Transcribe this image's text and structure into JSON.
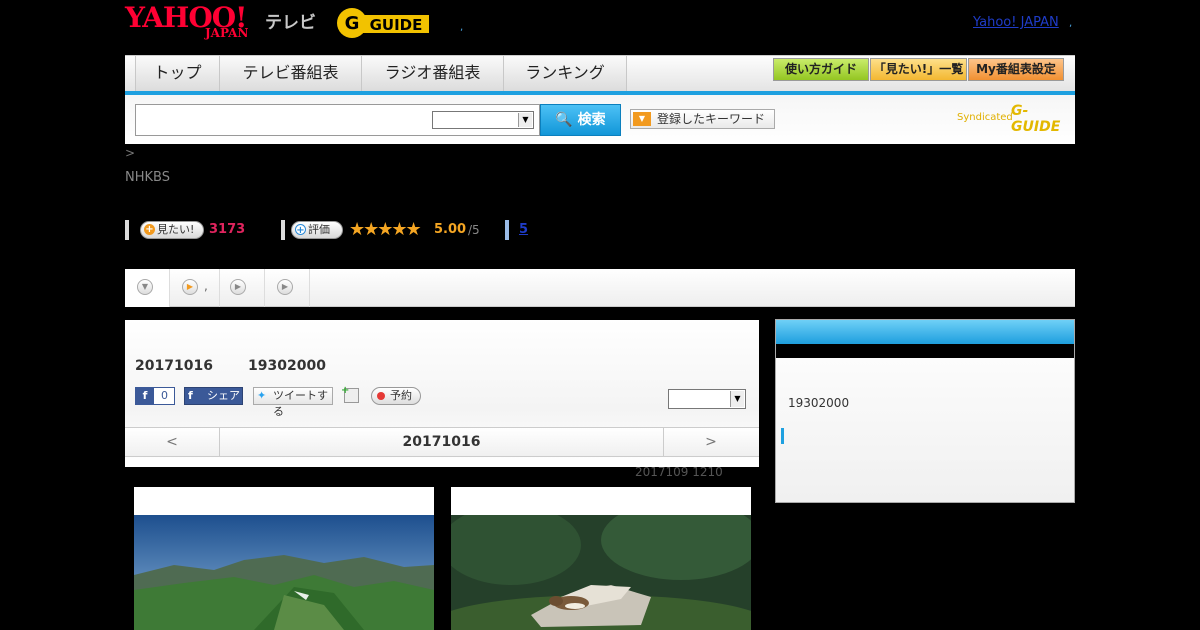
{
  "header": {
    "yahoo_logo": "YAHOO!",
    "yahoo_sub": "JAPAN",
    "tv_label": "テレビ",
    "gguide_logo": "G-GUIDE",
    "sep_dot": ",",
    "yahoo_japan_link": "Yahoo! JAPAN",
    "trailing_dot": ","
  },
  "nav": {
    "tabs": [
      "トップ",
      "テレビ番組表",
      "ラジオ番組表",
      "ランキング"
    ],
    "buttons": [
      "使い方ガイド",
      "「見たい!」一覧",
      "My番組表設定"
    ],
    "button_colors": [
      "#a6d63a",
      "#f6c84a",
      "#f6a24a"
    ]
  },
  "search": {
    "input_value": "",
    "select_value": "",
    "button_label": "検索",
    "keyword_button_label": "登録したキーワード",
    "syndicated_label": "Syndicated",
    "syndicated_logo": "G-GUIDE"
  },
  "info": {
    "breadcrumb": ">",
    "channel": "NHKBS",
    "want_label": "見たい!",
    "want_count": "3173",
    "rate_label": "評価",
    "stars": "★★★★★",
    "score": "5.00",
    "score_max": "/5",
    "reviews_link": "5"
  },
  "subtabs": [
    {
      "icon": "▼",
      "label": ""
    },
    {
      "icon": "▶",
      "label": ","
    },
    {
      "icon": "▶",
      "label": ""
    },
    {
      "icon": "▶",
      "label": ""
    }
  ],
  "main": {
    "date": "20171016",
    "time": "19302000",
    "fb_like_count": "0",
    "fb_share_label": "シェア",
    "tweet_label": "ツイートする",
    "reserve_label": "予約",
    "select_value": "",
    "prev": "<",
    "next": ">",
    "nav_date": "20171016",
    "updated": "2017109  1210"
  },
  "side": {
    "time": "19302000"
  },
  "colors": {
    "accent": "#1ea0e0",
    "count": "#e0245e",
    "star": "#f5a623"
  }
}
